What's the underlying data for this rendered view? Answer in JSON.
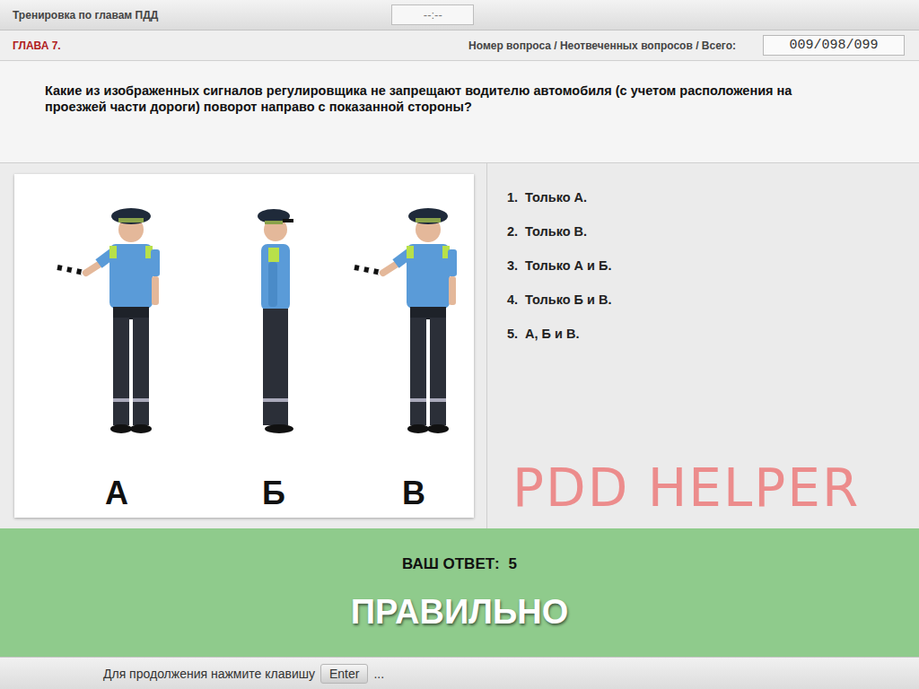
{
  "header": {
    "title": "Тренировка по главам ПДД",
    "timer": "--:--"
  },
  "info": {
    "chapter": "ГЛАВА 7.",
    "counter_label": "Номер вопроса / Неотвеченных вопросов / Всего:",
    "counter": "009/098/099"
  },
  "question": "Какие из изображенных сигналов регулировщика не запрещают водителю автомобиля (с учетом расположения на проезжей части дороги) поворот направо с показанной стороны?",
  "figures": [
    {
      "label": "А",
      "kind": "front"
    },
    {
      "label": "Б",
      "kind": "side"
    },
    {
      "label": "В",
      "kind": "front"
    }
  ],
  "answers": [
    {
      "number": "1.",
      "text": "Только А."
    },
    {
      "number": "2.",
      "text": "Только В."
    },
    {
      "number": "3.",
      "text": "Только А и Б."
    },
    {
      "number": "4.",
      "text": "Только Б и В."
    },
    {
      "number": "5.",
      "text": "А, Б и В."
    }
  ],
  "watermark": "PDD HELPER",
  "result": {
    "label": "ВАШ ОТВЕТ:",
    "answer": "5",
    "verdict": "ПРАВИЛЬНО",
    "correct": true
  },
  "footer": {
    "text": "Для продолжения нажмите клавишу",
    "key": "Enter",
    "suffix": "..."
  }
}
